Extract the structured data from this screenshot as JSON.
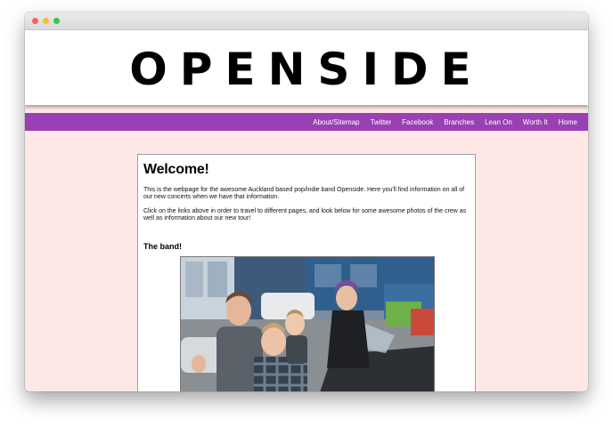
{
  "site": {
    "logo_text": "OPENSIDE"
  },
  "nav": {
    "items": [
      {
        "label": "About/Sitemap",
        "name": "nav-item-about-sitemap"
      },
      {
        "label": "Twitter",
        "name": "nav-item-twitter"
      },
      {
        "label": "Facebook",
        "name": "nav-item-facebook"
      },
      {
        "label": "Branches",
        "name": "nav-item-branches"
      },
      {
        "label": "Lean On",
        "name": "nav-item-lean-on"
      },
      {
        "label": "Worth It",
        "name": "nav-item-worth-it"
      },
      {
        "label": "Home",
        "name": "nav-item-home"
      }
    ]
  },
  "main": {
    "title": "Welcome!",
    "paragraphs": [
      "This is the webpage for the awesome Auckland based pop/indie band Openside. Here you'll find information on all of our new concerts when we have that information.",
      "Click on the links above in order to travel to different pages, and look below for some awesome photos of the crew as well as information about our new tour!"
    ],
    "band_heading": "The band!"
  },
  "colors": {
    "nav_bg": "#9b3fb4",
    "page_bg": "#fde8e6",
    "header_bg": "#ffffff"
  }
}
